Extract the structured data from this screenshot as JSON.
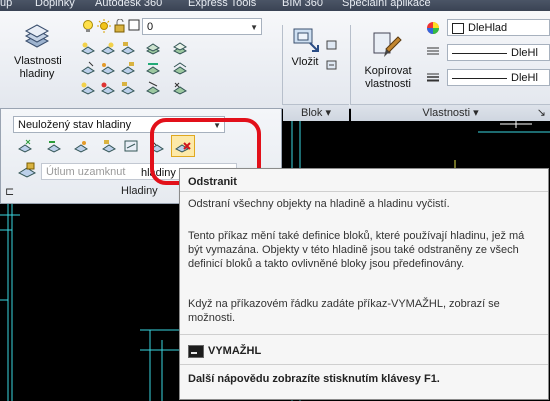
{
  "tabs": [
    "up",
    "Doplňky",
    "Autodesk 360",
    "Express Tools",
    "BIM 360",
    "Speciální aplikace"
  ],
  "layers_panel": {
    "properties_button_label": "Vlastnosti hladiny",
    "current_layer_value": "0",
    "state_combo_value": "Neuložený stav hladiny",
    "lock_fade_placeholder": "Útlum uzamknut",
    "title": "Hladiny",
    "title_suffix": "hladiny"
  },
  "block_panel": {
    "insert_label": "Vložit",
    "title": "Blok"
  },
  "properties_panel": {
    "match_properties_label": "Kopírovat vlastnosti",
    "color_value": "DleHlad",
    "linetype_value": "DleHl",
    "lineweight_value": "DleHl",
    "title": "Vlastnosti"
  },
  "tooltip": {
    "title": "Odstranit",
    "summary": "Odstraní všechny objekty na hladině a hladinu vyčistí.",
    "details": "Tento příkaz mění také definice bloků, které používají hladinu, jež má být vymazána. Objekty v této hladině jsou také odstraněny ze všech definicí bloků a takto ovlivněné bloky jsou předefinovány.",
    "command_hint": "Když na příkazovém řádku zadáte příkaz-VYMAŽHL, zobrazí se možnosti.",
    "command_name": "VYMAŽHL",
    "help_text": "Další nápovědu zobrazíte stisknutím klávesy F1."
  },
  "colors": {
    "highlight_ring": "#e2101a",
    "drawing_background": "#000000",
    "drawing_lines": "#3ad6e0"
  },
  "icons": [
    "layer-stack-icon",
    "bulb-icon",
    "sun-icon",
    "unlock-icon",
    "color-swatch-icon",
    "layer-tool-icon",
    "insert-block-icon",
    "match-properties-brush-icon",
    "color-wheel-icon",
    "pin-icon",
    "delete-layer-icon",
    "command-prompt-icon"
  ]
}
